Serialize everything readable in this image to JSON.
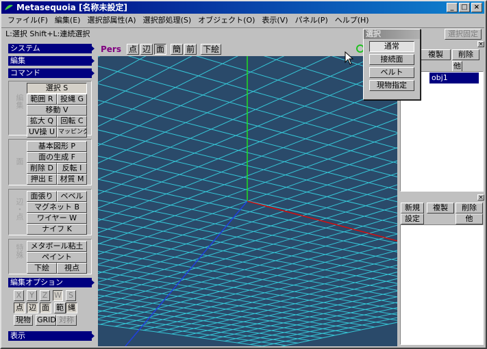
{
  "window": {
    "title": "Metasequoia [名称未設定]"
  },
  "titlebar_buttons": [
    "_",
    "□",
    "×"
  ],
  "menu": [
    "ファイル(F)",
    "編集(E)",
    "選択部属性(A)",
    "選択部処理(S)",
    "オブジェクト(O)",
    "表示(V)",
    "パネル(P)",
    "ヘルプ(H)"
  ],
  "status": {
    "hint": "L:選択  Shift+L:連続選択",
    "fixed_button": "選択固定"
  },
  "sidebar": {
    "sections": {
      "system": "システム",
      "edit": "編集",
      "command": "コマンド",
      "edit_option": "編集オプション",
      "display": "表示"
    },
    "groups": {
      "edit_label": "編集",
      "edit_rows": [
        [
          "選択 S"
        ],
        [
          "範囲 R",
          "投縄 G"
        ],
        [
          "移動 V"
        ],
        [
          "拡大 Q",
          "回転 C"
        ],
        [
          "UV操 U",
          "マッピング"
        ]
      ],
      "face_label": "面",
      "face_rows": [
        [
          "基本図形 P"
        ],
        [
          "面の生成 F"
        ],
        [
          "削除 D",
          "反転 I"
        ],
        [
          "押出 E",
          "材質 M"
        ]
      ],
      "vertex_label": "辺・点",
      "vertex_rows": [
        [
          "面張り",
          "ベベル"
        ],
        [
          "マグネット B"
        ],
        [
          "ワイヤー W"
        ],
        [
          "ナイフ K"
        ]
      ],
      "special_label": "特殊",
      "special_rows": [
        [
          "メタボール粘土"
        ],
        [
          "ペイント"
        ],
        [
          "下絵",
          "視点"
        ]
      ]
    },
    "options": {
      "axes": [
        "X",
        "Y",
        "Z",
        "W",
        "S"
      ],
      "mode_row": [
        "点",
        "辺",
        "面",
        "範",
        "縄"
      ],
      "last_row": [
        "現物",
        "GRID",
        "対称"
      ]
    }
  },
  "viewport": {
    "label": "Pers",
    "buttons": [
      "点",
      "辺",
      "面",
      "簡",
      "前",
      "下絵"
    ]
  },
  "object_panel": {
    "buttons": [
      "複製",
      "削除",
      "他"
    ],
    "object_name": "obj1"
  },
  "material_panel": {
    "buttons": [
      "新規",
      "複製",
      "削除",
      "設定",
      "他"
    ]
  },
  "select_popup": {
    "title": "選択",
    "buttons": [
      "通常",
      "接続面",
      "ベルト",
      "現物指定"
    ]
  },
  "colors": {
    "viewport_bg": "#2a4a6a",
    "grid": "#36c8d8",
    "x_axis": "#d01010",
    "y_axis": "#20e020",
    "z_axis": "#2040e0",
    "title_bar": "#000080"
  }
}
